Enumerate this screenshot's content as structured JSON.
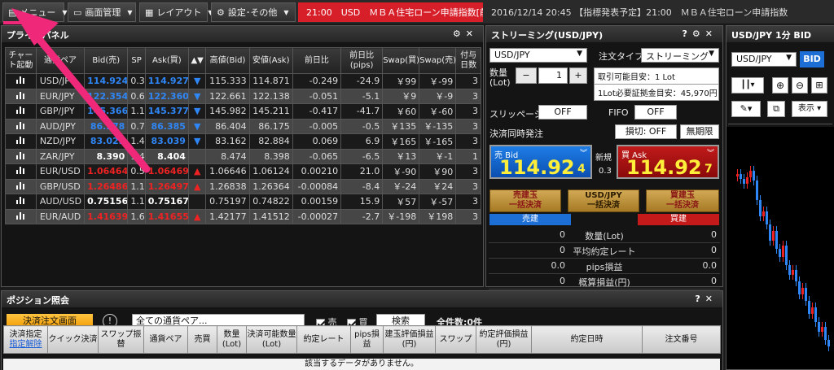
{
  "menu": {
    "menu_label": "メニュー",
    "screen_mgmt_label": "画面管理",
    "layout_label": "レイアウト",
    "settings_label": "設定･その他"
  },
  "alert_text": "21:00　USD　ＭＢＡ住宅ローン申請指数[前週",
  "news_text": "2016/12/14 20:45 【指標発表予定】21:00　ＭＢＡ住宅ローン申請指数",
  "price_panel": {
    "title": "プライスパネル",
    "columns": [
      "チャート起動",
      "通貨ペア",
      "Bid(売)",
      "SP",
      "Ask(買)",
      "▲▼",
      "高値(Bid)",
      "安値(Ask)",
      "前日比",
      "前日比(pips)",
      "Swap(買)",
      "Swap(売)",
      "付与日数"
    ],
    "rows": [
      {
        "pair": "USD/JPY",
        "bid": "114.924",
        "sp": "0.3",
        "ask": "114.927",
        "dir": "▼",
        "high": "115.333",
        "low": "114.871",
        "chg": "-0.249",
        "chg_pips": "-24.9",
        "swap_buy": "￥99",
        "swap_sell": "￥-99",
        "days": "3",
        "color": "blue"
      },
      {
        "pair": "EUR/JPY",
        "bid": "122.354",
        "sp": "0.6",
        "ask": "122.360",
        "dir": "▼",
        "high": "122.661",
        "low": "122.138",
        "chg": "-0.051",
        "chg_pips": "-5.1",
        "swap_buy": "￥9",
        "swap_sell": "￥-9",
        "days": "3",
        "color": "blue"
      },
      {
        "pair": "GBP/JPY",
        "bid": "145.366",
        "sp": "1.1",
        "ask": "145.377",
        "dir": "▼",
        "high": "145.982",
        "low": "145.211",
        "chg": "-0.417",
        "chg_pips": "-41.7",
        "swap_buy": "￥60",
        "swap_sell": "￥-60",
        "days": "3",
        "color": "blue"
      },
      {
        "pair": "AUD/JPY",
        "bid": "86.378",
        "sp": "0.7",
        "ask": "86.385",
        "dir": "▼",
        "high": "86.404",
        "low": "86.175",
        "chg": "-0.005",
        "chg_pips": "-0.5",
        "swap_buy": "￥135",
        "swap_sell": "￥-135",
        "days": "3",
        "color": "blue"
      },
      {
        "pair": "NZD/JPY",
        "bid": "83.025",
        "sp": "1.4",
        "ask": "83.039",
        "dir": "▼",
        "high": "83.162",
        "low": "82.884",
        "chg": "0.069",
        "chg_pips": "6.9",
        "swap_buy": "￥165",
        "swap_sell": "￥-165",
        "days": "3",
        "color": "blue"
      },
      {
        "pair": "ZAR/JPY",
        "bid": "8.390",
        "sp": "1.4",
        "ask": "8.404",
        "dir": "",
        "high": "8.474",
        "low": "8.398",
        "chg": "-0.065",
        "chg_pips": "-6.5",
        "swap_buy": "￥13",
        "swap_sell": "￥-1",
        "days": "1",
        "color": "white"
      },
      {
        "pair": "EUR/USD",
        "bid": "1.06464",
        "sp": "0.5",
        "ask": "1.06469",
        "dir": "▲",
        "high": "1.06646",
        "low": "1.06124",
        "chg": "0.00210",
        "chg_pips": "21.0",
        "swap_buy": "￥-90",
        "swap_sell": "￥90",
        "days": "3",
        "color": "red"
      },
      {
        "pair": "GBP/USD",
        "bid": "1.26486",
        "sp": "1.1",
        "ask": "1.26497",
        "dir": "▲",
        "high": "1.26838",
        "low": "1.26364",
        "chg": "-0.00084",
        "chg_pips": "-8.4",
        "swap_buy": "￥-24",
        "swap_sell": "￥24",
        "days": "3",
        "color": "red"
      },
      {
        "pair": "AUD/USD",
        "bid": "0.75156",
        "sp": "1.1",
        "ask": "0.75167",
        "dir": "",
        "high": "0.75197",
        "low": "0.74822",
        "chg": "0.00159",
        "chg_pips": "15.9",
        "swap_buy": "￥57",
        "swap_sell": "￥-57",
        "days": "3",
        "color": "white"
      },
      {
        "pair": "EUR/AUD",
        "bid": "1.41639",
        "sp": "1.6",
        "ask": "1.41655",
        "dir": "▲",
        "high": "1.42177",
        "low": "1.41512",
        "chg": "-0.00027",
        "chg_pips": "-2.7",
        "swap_buy": "￥-198",
        "swap_sell": "￥198",
        "days": "3",
        "color": "red"
      }
    ]
  },
  "streaming": {
    "title": "ストリーミング(USD/JPY)",
    "pair": "USD/JPY",
    "order_type_label": "注文タイプ",
    "order_type": "ストリーミング",
    "qty_label_1": "数量",
    "qty_label_2": "(Lot)",
    "qty_minus": "−",
    "qty_value": "1",
    "qty_plus": "+",
    "tradable": "取引可能目安：1 Lot",
    "margin": "1Lot必要証拠金目安：45,970円",
    "slippage_label": "スリッページ",
    "slippage_value": "OFF",
    "fifo_label": "FIFO",
    "fifo_value": "OFF",
    "simul_label": "決済同時発注",
    "stoploss_value": "損切: OFF",
    "unlimited_value": "無期限",
    "bid_label": "売 Bid",
    "bid_main": "114.92",
    "bid_last": "4",
    "ask_label": "買 Ask",
    "ask_main": "114.92",
    "ask_last": "7",
    "new_label": "新規",
    "spread": "0.3",
    "close_sell_1": "売建玉",
    "close_sell_2": "一括決済",
    "close_pair_1": "USD/JPY",
    "close_pair_2": "一括決済",
    "close_buy_1": "買建玉",
    "close_buy_2": "一括決済",
    "sell_header": "売建",
    "buy_header": "買建",
    "rows": [
      {
        "left": "0",
        "label": "数量(Lot)",
        "right": "0"
      },
      {
        "left": "0",
        "label": "平均約定レート",
        "right": "0"
      },
      {
        "left": "0.0",
        "label": "pips損益",
        "right": "0.0"
      },
      {
        "left": "0",
        "label": "概算損益(円)",
        "right": "0"
      }
    ]
  },
  "chart_panel": {
    "title": "USD/JPY 1分 BID",
    "pair": "USD/JPY",
    "bid_btn": "BID",
    "display_label": "表示"
  },
  "position": {
    "title": "ポジション照会",
    "settle_screen_btn": "決済注文画面",
    "filter_value": "全ての通貨ペア...",
    "sell_label": "売",
    "buy_label": "買",
    "search_btn": "検索",
    "total": "全件数:0件",
    "columns": [
      "決済指定",
      "クイック決済",
      "スワップ振替",
      "通貨ペア",
      "売買",
      "数量(Lot)",
      "決済可能数量(Lot)",
      "約定レート",
      "pips損益",
      "建玉評価損益(円)",
      "スワップ",
      "約定評価損益(円)",
      "約定日時",
      "注文番号"
    ],
    "unassign": "指定解除",
    "empty_message": "該当するデータがありません。"
  }
}
